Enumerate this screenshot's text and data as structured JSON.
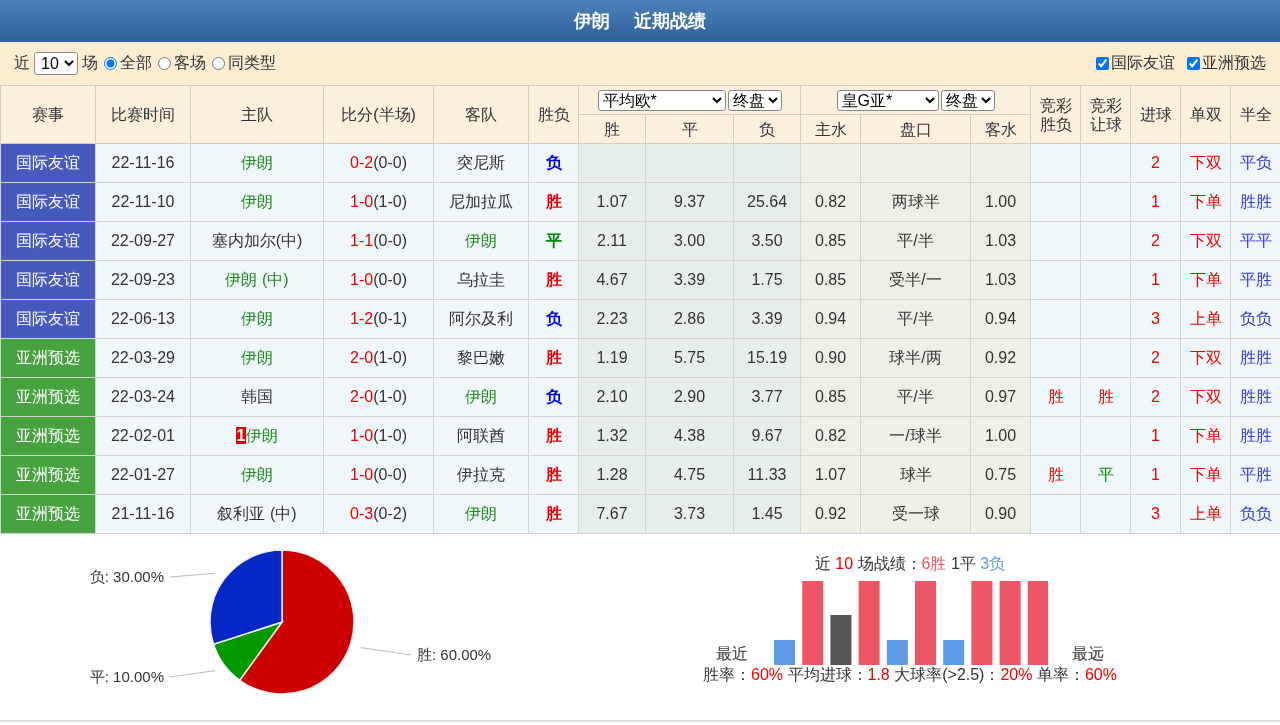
{
  "title": {
    "team": "伊朗",
    "text": "近期战绩"
  },
  "filters": {
    "prefix": "近",
    "count": "10",
    "suffix": "场",
    "scope": [
      {
        "label": "全部",
        "selected": true
      },
      {
        "label": "客场",
        "selected": false
      },
      {
        "label": "同类型",
        "selected": false
      }
    ],
    "leagues": [
      {
        "label": "国际友谊",
        "checked": true
      },
      {
        "label": "亚洲预选",
        "checked": true
      }
    ]
  },
  "columns": {
    "league": "赛事",
    "time": "比赛时间",
    "home": "主队",
    "score": "比分(半场)",
    "away": "客队",
    "result": "胜负",
    "euro_company": "平均欧*",
    "euro_stage": "终盘",
    "euro": [
      "胜",
      "平",
      "负"
    ],
    "asia_company": "皇G亚*",
    "asia_stage": "终盘",
    "asia": [
      "主水",
      "盘口",
      "客水"
    ],
    "jc_result": "竞彩胜负",
    "jc_handicap": "竞彩让球",
    "goals": "进球",
    "odd_even": "单双",
    "half_full": "半全"
  },
  "rows": [
    {
      "league": "国际友谊",
      "color": "#4759bd",
      "time": "22-11-16",
      "home": {
        "name": "伊朗",
        "focus": true
      },
      "score": "0-2",
      "half": "(0-0)",
      "away": {
        "name": "突尼斯",
        "focus": false
      },
      "result": {
        "text": "负",
        "kind": "loss"
      },
      "euro": [],
      "asia": [],
      "goals": "2",
      "odd_even": "下双",
      "half_full": "平负"
    },
    {
      "league": "国际友谊",
      "color": "#4759bd",
      "time": "22-11-10",
      "home": {
        "name": "伊朗",
        "focus": true
      },
      "score": "1-0",
      "half": "(1-0)",
      "away": {
        "name": "尼加拉瓜",
        "focus": false
      },
      "result": {
        "text": "胜",
        "kind": "win"
      },
      "euro": [
        "1.07",
        "9.37",
        "25.64"
      ],
      "asia": [
        "0.82",
        "两球半",
        "1.00"
      ],
      "goals": "1",
      "odd_even": "下单",
      "half_full": "胜胜"
    },
    {
      "league": "国际友谊",
      "color": "#4759bd",
      "time": "22-09-27",
      "home": {
        "name": "塞内加尔(中)",
        "focus": false
      },
      "score": "1-1",
      "half": "(0-0)",
      "away": {
        "name": "伊朗",
        "focus": true
      },
      "result": {
        "text": "平",
        "kind": "draw"
      },
      "euro": [
        "2.11",
        "3.00",
        "3.50"
      ],
      "asia": [
        "0.85",
        "平/半",
        "1.03"
      ],
      "goals": "2",
      "odd_even": "下双",
      "half_full": "平平"
    },
    {
      "league": "国际友谊",
      "color": "#4759bd",
      "time": "22-09-23",
      "home": {
        "name": "伊朗 (中)",
        "focus": true
      },
      "score": "1-0",
      "half": "(0-0)",
      "away": {
        "name": "乌拉圭",
        "focus": false
      },
      "result": {
        "text": "胜",
        "kind": "win"
      },
      "euro": [
        "4.67",
        "3.39",
        "1.75"
      ],
      "asia": [
        "0.85",
        "受半/一",
        "1.03"
      ],
      "goals": "1",
      "odd_even": "下单",
      "half_full": "平胜"
    },
    {
      "league": "国际友谊",
      "color": "#4759bd",
      "time": "22-06-13",
      "home": {
        "name": "伊朗",
        "focus": true
      },
      "score": "1-2",
      "half": "(0-1)",
      "away": {
        "name": "阿尔及利",
        "focus": false
      },
      "result": {
        "text": "负",
        "kind": "loss"
      },
      "euro": [
        "2.23",
        "2.86",
        "3.39"
      ],
      "asia": [
        "0.94",
        "平/半",
        "0.94"
      ],
      "goals": "3",
      "odd_even": "上单",
      "half_full": "负负"
    },
    {
      "league": "亚洲预选",
      "color": "#48a23f",
      "time": "22-03-29",
      "home": {
        "name": "伊朗",
        "focus": true
      },
      "score": "2-0",
      "half": "(1-0)",
      "away": {
        "name": "黎巴嫩",
        "focus": false
      },
      "result": {
        "text": "胜",
        "kind": "win"
      },
      "euro": [
        "1.19",
        "5.75",
        "15.19"
      ],
      "asia": [
        "0.90",
        "球半/两",
        "0.92"
      ],
      "goals": "2",
      "odd_even": "下双",
      "half_full": "胜胜"
    },
    {
      "league": "亚洲预选",
      "color": "#48a23f",
      "time": "22-03-24",
      "home": {
        "name": "韩国",
        "focus": false
      },
      "score": "2-0",
      "half": "(1-0)",
      "away": {
        "name": "伊朗",
        "focus": true
      },
      "result": {
        "text": "负",
        "kind": "loss"
      },
      "euro": [
        "2.10",
        "2.90",
        "3.77"
      ],
      "asia": [
        "0.85",
        "平/半",
        "0.97"
      ],
      "jc_result": {
        "text": "胜",
        "kind": "win"
      },
      "jc_handicap": {
        "text": "胜",
        "kind": "win"
      },
      "goals": "2",
      "odd_even": "下双",
      "half_full": "胜胜"
    },
    {
      "league": "亚洲预选",
      "color": "#48a23f",
      "time": "22-02-01",
      "home": {
        "name": "伊朗",
        "focus": true,
        "badge": "1"
      },
      "score": "1-0",
      "half": "(1-0)",
      "away": {
        "name": "阿联酋",
        "focus": false
      },
      "result": {
        "text": "胜",
        "kind": "win"
      },
      "euro": [
        "1.32",
        "4.38",
        "9.67"
      ],
      "asia": [
        "0.82",
        "一/球半",
        "1.00"
      ],
      "goals": "1",
      "odd_even": "下单",
      "half_full": "胜胜"
    },
    {
      "league": "亚洲预选",
      "color": "#48a23f",
      "time": "22-01-27",
      "home": {
        "name": "伊朗",
        "focus": true
      },
      "score": "1-0",
      "half": "(0-0)",
      "away": {
        "name": "伊拉克",
        "focus": false
      },
      "result": {
        "text": "胜",
        "kind": "win"
      },
      "euro": [
        "1.28",
        "4.75",
        "11.33"
      ],
      "asia": [
        "1.07",
        "球半",
        "0.75"
      ],
      "jc_result": {
        "text": "胜",
        "kind": "win"
      },
      "jc_handicap": {
        "text": "平",
        "kind": "draw"
      },
      "goals": "1",
      "odd_even": "下单",
      "half_full": "平胜"
    },
    {
      "league": "亚洲预选",
      "color": "#48a23f",
      "time": "21-11-16",
      "home": {
        "name": "叙利亚 (中)",
        "focus": false
      },
      "score": "0-3",
      "half": "(0-2)",
      "away": {
        "name": "伊朗",
        "focus": true
      },
      "result": {
        "text": "胜",
        "kind": "win"
      },
      "euro": [
        "7.67",
        "3.73",
        "1.45"
      ],
      "asia": [
        "0.92",
        "受一球",
        "0.90"
      ],
      "goals": "3",
      "odd_even": "上单",
      "half_full": "负负"
    }
  ],
  "pie": {
    "chart_data": {
      "type": "pie",
      "series": [
        {
          "values": [
            60,
            10,
            30
          ]
        }
      ],
      "colors": [
        "#cc0000",
        "#009900",
        "#0527c6"
      ],
      "value_labels": [
        "胜: 60.00%",
        "平: 10.00%",
        "负: 30.00%"
      ]
    }
  },
  "summary": {
    "prefix": "近",
    "count": "10",
    "suffix": "场战绩：",
    "wins": "6胜",
    "draws": "1平",
    "losses": "3负",
    "recent": "最近",
    "oldest": "最远",
    "stats": [
      {
        "label": "胜率：",
        "value": "60%"
      },
      {
        "label": "平均进球：",
        "value": "1.8"
      },
      {
        "label": "大球率(>2.5)：",
        "value": "20%"
      },
      {
        "label": "单率：",
        "value": "60%"
      }
    ]
  }
}
